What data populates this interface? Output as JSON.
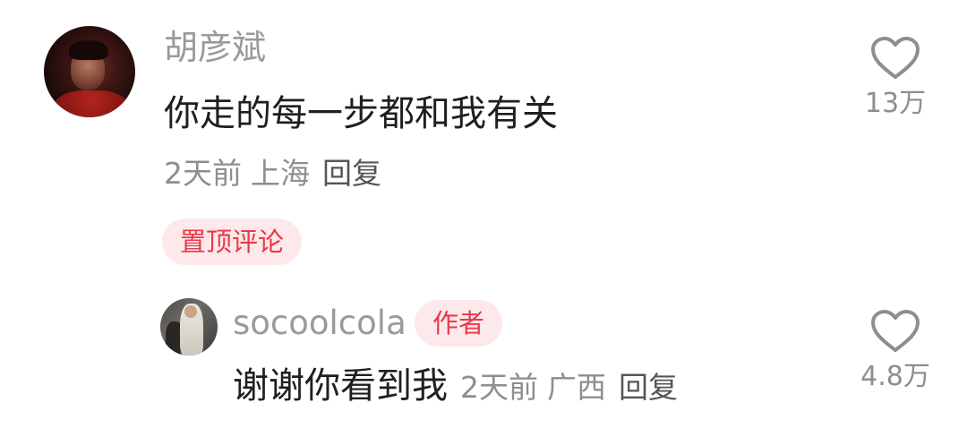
{
  "main_comment": {
    "username": "胡彦斌",
    "text": "你走的每一步都和我有关",
    "time": "2天前",
    "location": "上海",
    "reply_label": "回复",
    "pinned_label": "置顶评论",
    "like_count": "13万"
  },
  "reply_comment": {
    "username": "socoolcola",
    "author_badge": "作者",
    "text": "谢谢你看到我",
    "time": "2天前",
    "location": "广西",
    "reply_label": "回复",
    "like_count": "4.8万"
  },
  "colors": {
    "accent": "#e8394a",
    "badge_bg": "#fde8ea",
    "secondary_text": "#8e8e8e",
    "primary_text": "#1f1f1f"
  },
  "icons": {
    "like": "heart-outline-icon"
  }
}
